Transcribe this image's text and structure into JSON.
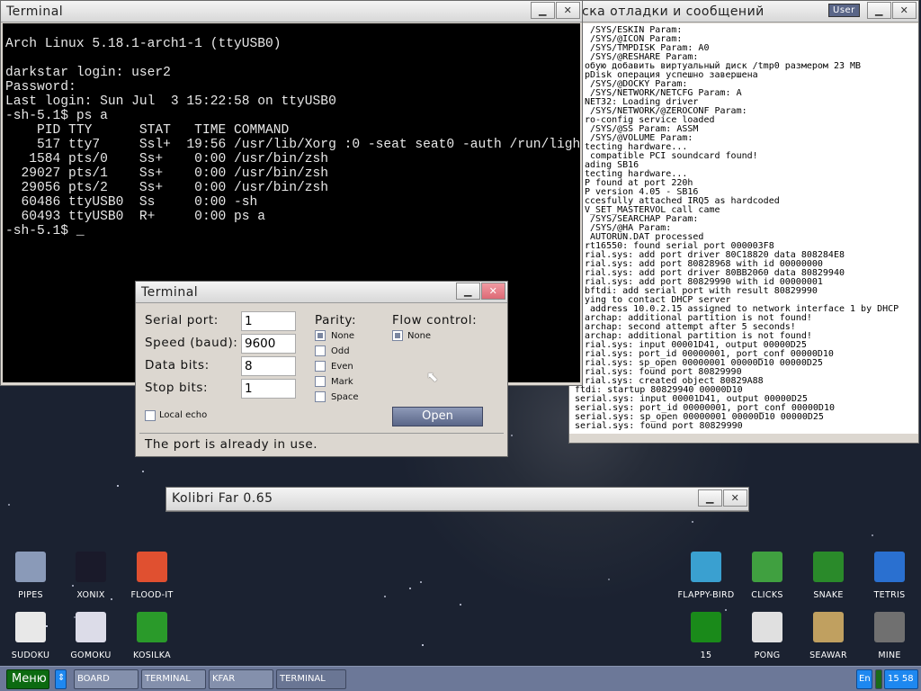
{
  "log_window": {
    "title": "ска отладки и сообщений",
    "user_button": "User",
    "lines": [
      " /SYS/ESKIN Param:",
      " /SYS/@ICON Param:",
      " /SYS/TMPDISK Param: A0",
      " /SYS/@RESHARE Param:",
      "обую добавить виртуальный диск /tmp0 размером 23 MB",
      "pDisk операция успешно завершена",
      " /SYS/@DOCKY Param:",
      " /SYS/NETWORK/NETCFG Param: A",
      "NET32: Loading driver",
      " /SYS/NETWORK/@ZEROCONF Param:",
      "ro-config service loaded",
      " /SYS/@SS Param: ASSM",
      " /SYS/@VOLUME Param:",
      "tecting hardware...",
      " compatible PCI soundcard found!",
      "ading SB16",
      "tecting hardware...",
      "P found at port 220h",
      "P version 4.05 - SB16",
      "ccesfully attached IRQ5 as hardcoded",
      "V_SET_MASTERVOL call came",
      " /SYS/SEARCHAP Param:",
      " /SYS/@HA Param:",
      " AUTORUN.DAT processed",
      "rt16550: found serial port 000003F8",
      "rial.sys: add port driver 80C18820 data 808284E8",
      "rial.sys: add port 80828968 with id 00000000",
      "rial.sys: add port driver 80BB2060 data 80829940",
      "rial.sys: add port 80829990 with id 00000001",
      "bftdi: add serial port with result 80829990",
      "ying to contact DHCP server",
      " address 10.0.2.15 assigned to network interface 1 by DHCP",
      "archap: additional partition is not found!",
      "archap: second attempt after 5 seconds!",
      "archap: additional partition is not found!",
      "rial.sys: input 00001D41, output 00000D25",
      "rial.sys: port_id 00000001, port_conf 00000D10",
      "rial.sys: sp_open 00000001 00000D10 00000D25",
      "rial.sys: found port 80829990",
      "rial.sys: created object 80829A88",
      "ftdi: startup 80829940 00000D10",
      "serial.sys: input 00001D41, output 00000D25",
      "serial.sys: port_id 00000001, port_conf 00000D10",
      "serial.sys: sp_open 00000001 00000D10 00000D25",
      "serial.sys: found port 80829990"
    ]
  },
  "terminal_window": {
    "title": "Terminal",
    "output": "Arch Linux 5.18.1-arch1-1 (ttyUSB0)\n\ndarkstar login: user2\nPassword:\nLast login: Sun Jul  3 15:22:58 on ttyUSB0\n-sh-5.1$ ps a\n    PID TTY      STAT   TIME COMMAND\n    517 tty7     Ssl+  19:56 /usr/lib/Xorg :0 -seat seat0 -auth /run/lightdm/roo\n   1584 pts/0    Ss+    0:00 /usr/bin/zsh\n  29027 pts/1    Ss+    0:00 /usr/bin/zsh\n  29056 pts/2    Ss+    0:00 /usr/bin/zsh\n  60486 ttyUSB0  Ss     0:00 -sh\n  60493 ttyUSB0  R+     0:00 ps a\n-sh-5.1$ _"
  },
  "dialog": {
    "title": "Terminal",
    "serial_port_label": "Serial port:",
    "serial_port": "1",
    "speed_label": "Speed (baud):",
    "speed": "9600",
    "data_bits_label": "Data bits:",
    "data_bits": "8",
    "stop_bits_label": "Stop bits:",
    "stop_bits": "1",
    "local_echo": "Local echo",
    "parity_label": "Parity:",
    "parity_options": [
      "None",
      "Odd",
      "Even",
      "Mark",
      "Space"
    ],
    "parity_selected": "None",
    "flow_label": "Flow control:",
    "flow_options": [
      "None"
    ],
    "open_button": "Open",
    "status": "The port is already in use."
  },
  "kfar_window": {
    "title": "Kolibri Far 0.65"
  },
  "desktop_icons": [
    {
      "label": "PIPES",
      "icon": "pipes-icon"
    },
    {
      "label": "XONIX",
      "icon": "xonix-icon"
    },
    {
      "label": "FLOOD-IT",
      "icon": "flood-it-icon"
    },
    {
      "label": "SUDOKU",
      "icon": "sudoku-icon"
    },
    {
      "label": "GOMOKU",
      "icon": "gomoku-icon"
    },
    {
      "label": "KOSILKA",
      "icon": "lawnmower-icon"
    },
    {
      "label": "FLAPPY-BIRD",
      "icon": "bird-icon"
    },
    {
      "label": "CLICKS",
      "icon": "clicks-icon"
    },
    {
      "label": "SNAKE",
      "icon": "snake-icon"
    },
    {
      "label": "TETRIS",
      "icon": "tetris-icon"
    },
    {
      "label": "15",
      "icon": "fifteen-icon"
    },
    {
      "label": "PONG",
      "icon": "pong-icon"
    },
    {
      "label": "SEAWAR",
      "icon": "ship-icon"
    },
    {
      "label": "MINE",
      "icon": "mine-icon"
    }
  ],
  "taskbar": {
    "menu": "Меню",
    "tasks": [
      "BOARD",
      "TERMINAL",
      "KFAR",
      "TERMINAL"
    ],
    "lang": "En",
    "clock": "15 58"
  }
}
